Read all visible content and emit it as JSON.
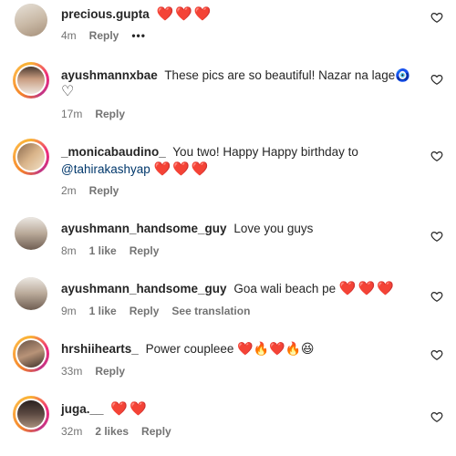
{
  "comments": [
    {
      "username": "precious.gupta",
      "text": "",
      "mention": "",
      "emoji": "❤️❤️❤️",
      "time": "4m",
      "likes": "",
      "reply": "Reply",
      "extra": "•••",
      "translate": ""
    },
    {
      "username": "ayushmannxbae",
      "text": "These pics are so beautiful! Nazar na lage🧿",
      "mention": "",
      "emoji": "♡",
      "time": "17m",
      "likes": "",
      "reply": "Reply",
      "extra": "",
      "translate": ""
    },
    {
      "username": "_monicabaudino_",
      "text": "You two! Happy Happy birthday to",
      "mention": "@tahirakashyap",
      "emoji": "❤️❤️❤️",
      "time": "2m",
      "likes": "",
      "reply": "Reply",
      "extra": "",
      "translate": ""
    },
    {
      "username": "ayushmann_handsome_guy",
      "text": "Love you guys",
      "mention": "",
      "emoji": "",
      "time": "8m",
      "likes": "1 like",
      "reply": "Reply",
      "extra": "",
      "translate": ""
    },
    {
      "username": "ayushmann_handsome_guy",
      "text": "Goa wali beach pe",
      "mention": "",
      "emoji": "❤️❤️❤️",
      "time": "9m",
      "likes": "1 like",
      "reply": "Reply",
      "extra": "",
      "translate": "See translation"
    },
    {
      "username": "hrshiihearts_",
      "text": "Power coupleee",
      "mention": "",
      "emoji": "❤️🔥❤️🔥😆",
      "time": "33m",
      "likes": "",
      "reply": "Reply",
      "extra": "",
      "translate": ""
    },
    {
      "username": "juga.__",
      "text": "",
      "mention": "",
      "emoji": "❤️❤️",
      "time": "32m",
      "likes": "2 likes",
      "reply": "Reply",
      "extra": "",
      "translate": ""
    }
  ],
  "icons": {
    "like": "heart-outline-icon"
  },
  "colors": {
    "mention": "#00376b",
    "meta": "#737373",
    "heart": "#ed1d25"
  }
}
